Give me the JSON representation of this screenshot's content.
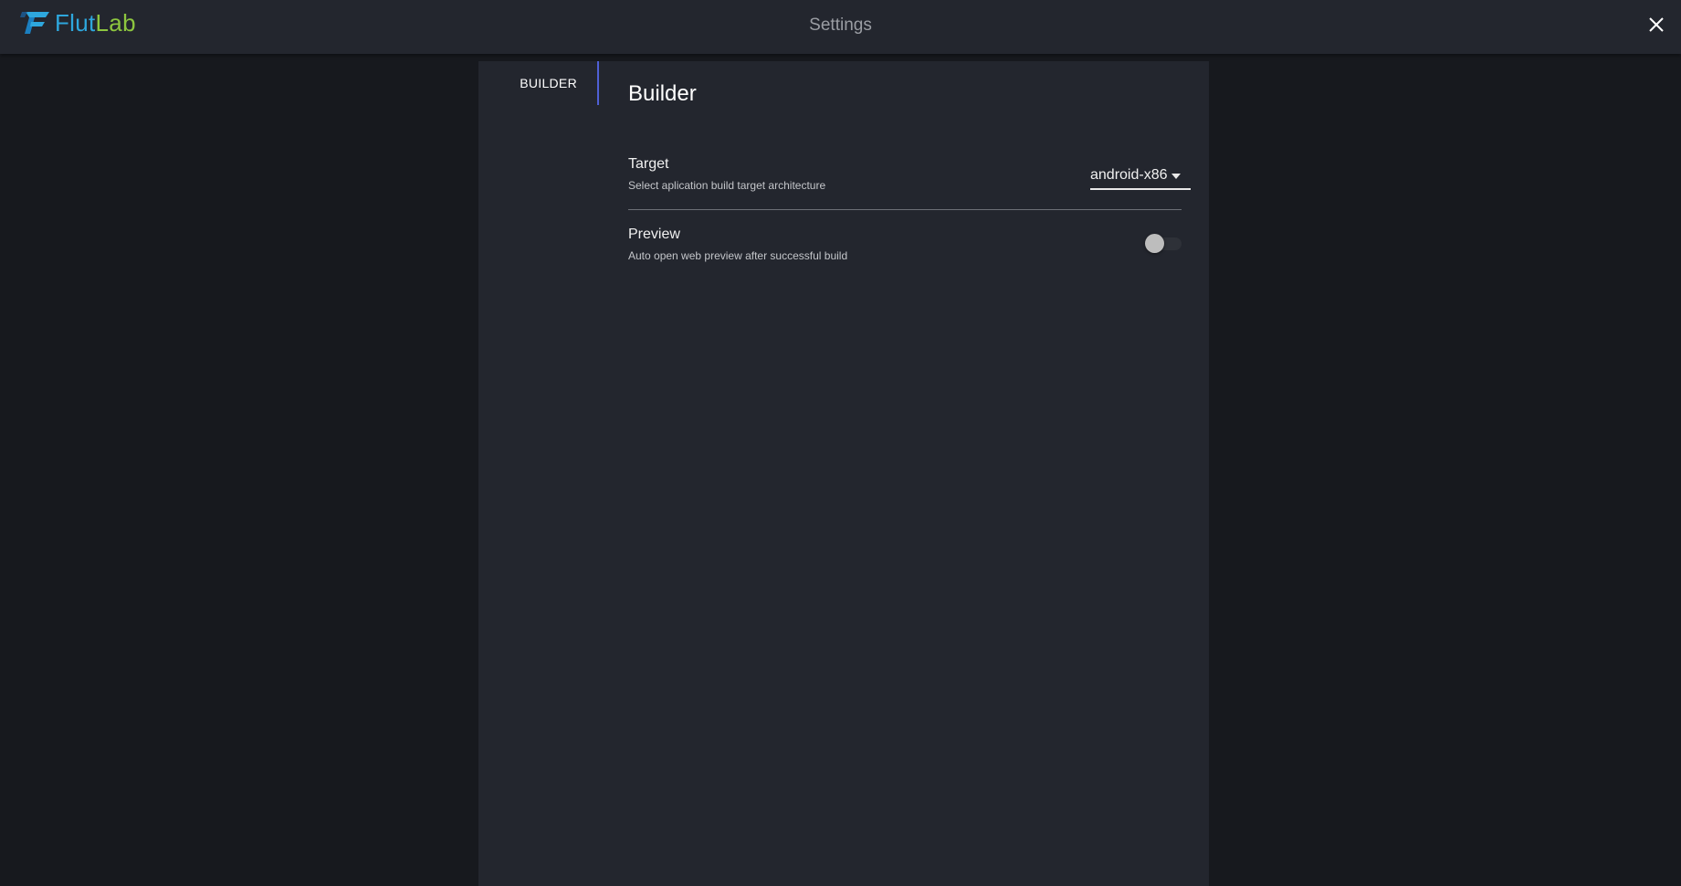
{
  "app": {
    "brand_part1": "Flut",
    "brand_part2": "Lab",
    "brand_colors": {
      "flut": "#2ea7dd",
      "lab": "#8dc63f"
    },
    "page_title": "Settings",
    "close_icon": "close-icon"
  },
  "nav": {
    "items": [
      {
        "label": "BUILDER",
        "active": true
      }
    ],
    "accent_color": "#4f5fd5"
  },
  "builder": {
    "title": "Builder",
    "target": {
      "label": "Target",
      "description": "Select aplication build target architecture",
      "value": "android-x86",
      "icon": "caret-down-icon"
    },
    "preview": {
      "label": "Preview",
      "description": "Auto open web preview after successful build",
      "enabled": false
    }
  }
}
